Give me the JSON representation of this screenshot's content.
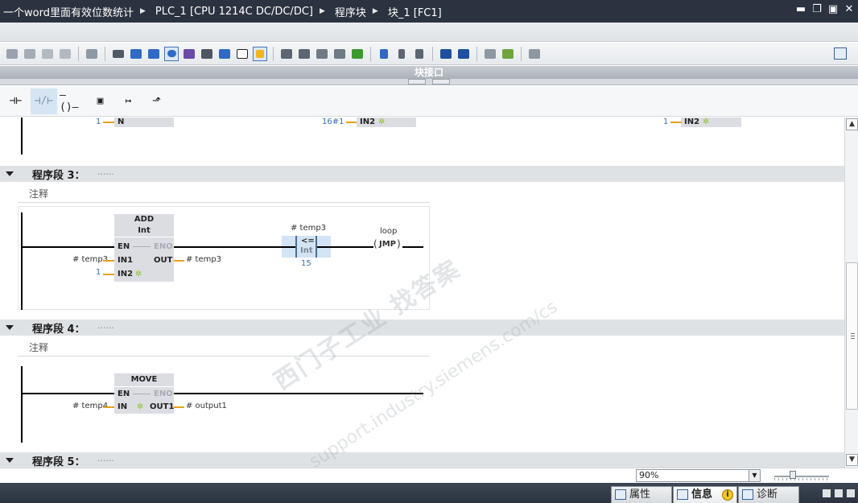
{
  "title_bar": {
    "crumbs": [
      "一个word里面有效位数统计",
      "PLC_1 [CPU 1214C DC/DC/DC]",
      "程序块",
      "块_1 [FC1]"
    ],
    "window_controls": [
      "minimize-icon",
      "restore-icon",
      "maximize-icon",
      "close-icon"
    ]
  },
  "interface_bar": {
    "label": "块接口"
  },
  "lad_bar": {
    "items": [
      "contact-no",
      "contact-nc",
      "coil",
      "empty-box",
      "open-branch",
      "close-branch"
    ]
  },
  "network2_tail": {
    "n_value": "1",
    "n_pin": "N",
    "in2_a_value": "16#1",
    "in2_a_pin": "IN2",
    "in2_b_value": "1",
    "in2_b_pin": "IN2"
  },
  "network3": {
    "label": "程序段 3：",
    "dots": "......",
    "comment": "注释",
    "add_box": {
      "title": "ADD",
      "type": "Int",
      "en": "EN",
      "eno": "ENO",
      "in1": "IN1",
      "in2": "IN2",
      "out": "OUT"
    },
    "in1_operand": "# temp3",
    "in2_operand": "1",
    "out_operand": "# temp3",
    "compare": {
      "operand": "# temp3",
      "symbol": "<=",
      "type": "Int",
      "value": "15"
    },
    "jump": {
      "label": "loop",
      "coil": "JMP"
    }
  },
  "network4": {
    "label": "程序段 4：",
    "dots": "......",
    "comment": "注释",
    "move_box": {
      "title": "MOVE",
      "en": "EN",
      "eno": "ENO",
      "in": "IN",
      "out1": "OUT1"
    },
    "in_operand": "# temp4",
    "out_operand": "# output1"
  },
  "network5": {
    "label": "程序段 5：",
    "dots": "......"
  },
  "watermark": {
    "line1": "西门子工业 找答案",
    "line2": "support.industry.siemens.com/cs"
  },
  "zoom": {
    "value": "90%"
  },
  "status_tabs": [
    {
      "label": "属性",
      "icon": "properties-icon"
    },
    {
      "label": "信息",
      "icon": "info-icon"
    },
    {
      "label": "诊断",
      "icon": "diagnostics-icon"
    }
  ],
  "info_badge": "i"
}
